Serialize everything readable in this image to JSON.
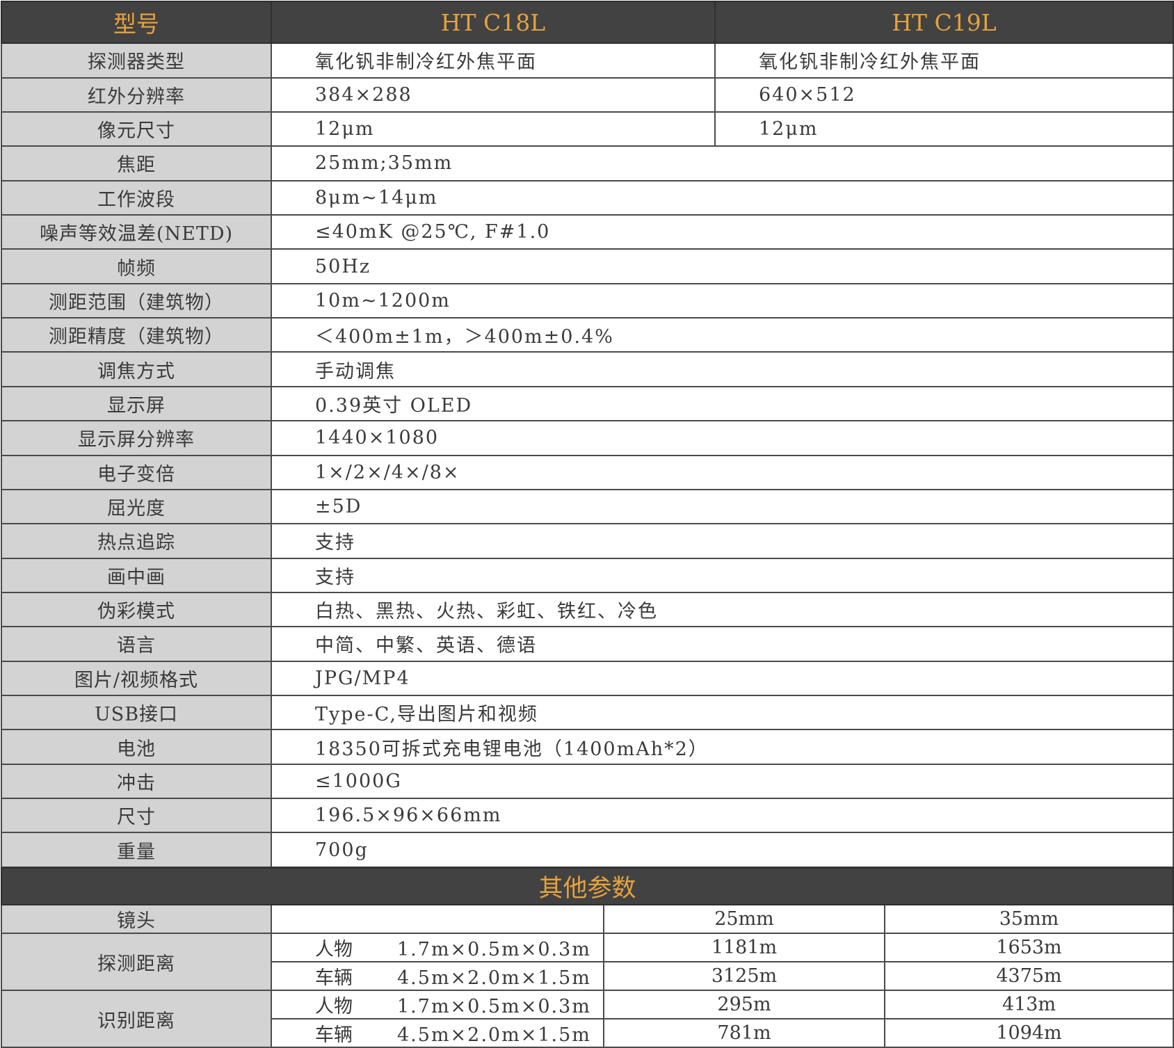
{
  "header": {
    "model_label": "型号",
    "models": [
      "HT C18L",
      "HT C19L"
    ]
  },
  "specs_split": [
    {
      "label": "探测器类型",
      "c18l": "氧化钒非制冷红外焦平面",
      "c19l": "氧化钒非制冷红外焦平面"
    },
    {
      "label": "红外分辨率",
      "c18l": "384×288",
      "c19l": "640×512"
    },
    {
      "label": "像元尺寸",
      "c18l": "12μm",
      "c19l": "12μm"
    }
  ],
  "specs_shared": [
    {
      "label": "焦距",
      "value": "25mm;35mm"
    },
    {
      "label": "工作波段",
      "value": "8μm~14μm"
    },
    {
      "label": "噪声等效温差(NETD)",
      "value": "≤40mK @25℃, F#1.0"
    },
    {
      "label": "帧频",
      "value": "50Hz"
    },
    {
      "label": "测距范围（建筑物）",
      "value": "10m~1200m"
    },
    {
      "label": "测距精度（建筑物）",
      "value": "＜400m±1m，＞400m±0.4%"
    },
    {
      "label": "调焦方式",
      "value": "手动调焦"
    },
    {
      "label": "显示屏",
      "value": "0.39英寸 OLED"
    },
    {
      "label": "显示屏分辨率",
      "value": "1440×1080"
    },
    {
      "label": "电子变倍",
      "value": "1×/2×/4×/8×"
    },
    {
      "label": "屈光度",
      "value": "±5D"
    },
    {
      "label": "热点追踪",
      "value": "支持"
    },
    {
      "label": "画中画",
      "value": "支持"
    },
    {
      "label": "伪彩模式",
      "value": "白热、黑热、火热、彩虹、铁红、冷色"
    },
    {
      "label": "语言",
      "value": "中简、中繁、英语、德语"
    },
    {
      "label": "图片/视频格式",
      "value": "JPG/MP4"
    },
    {
      "label": "USB接口",
      "value": "Type-C,导出图片和视频"
    },
    {
      "label": "电池",
      "value": "18350可拆式充电锂电池（1400mAh*2）"
    },
    {
      "label": "冲击",
      "value": "≤1000G"
    },
    {
      "label": "尺寸",
      "value": "196.5×96×66mm"
    },
    {
      "label": "重量",
      "value": "700g"
    }
  ],
  "other": {
    "title": "其他参数",
    "lens_label": "镜头",
    "lenses": [
      "25mm",
      "35mm"
    ],
    "groups": [
      {
        "label": "探测距离",
        "rows": [
          {
            "target": "人物",
            "size": "1.7m×0.5m×0.3m",
            "d25": "1181m",
            "d35": "1653m"
          },
          {
            "target": "车辆",
            "size": "4.5m×2.0m×1.5m",
            "d25": "3125m",
            "d35": "4375m"
          }
        ]
      },
      {
        "label": "识别距离",
        "rows": [
          {
            "target": "人物",
            "size": "1.7m×0.5m×0.3m",
            "d25": "295m",
            "d35": "413m"
          },
          {
            "target": "车辆",
            "size": "4.5m×2.0m×1.5m",
            "d25": "781m",
            "d35": "1094m"
          }
        ]
      }
    ]
  }
}
